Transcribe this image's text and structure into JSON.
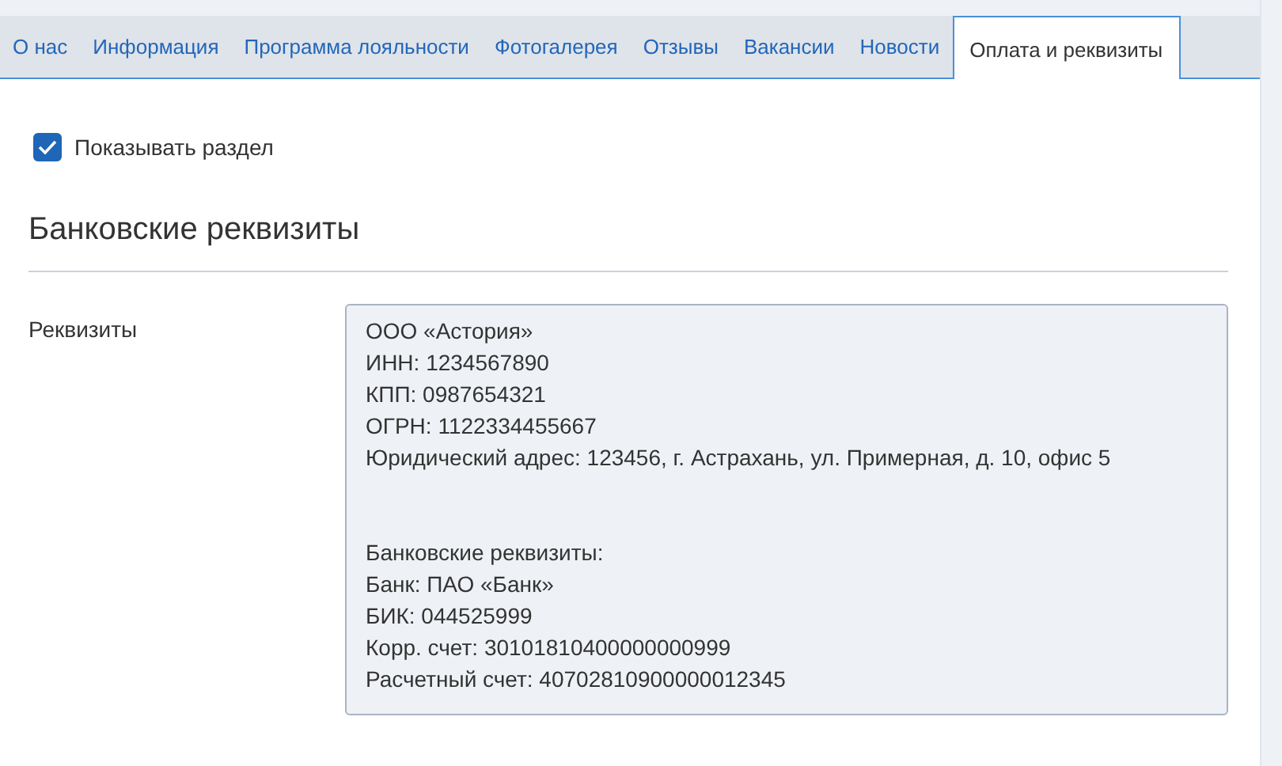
{
  "tabs": [
    {
      "label": "О нас",
      "selected": false
    },
    {
      "label": "Информация",
      "selected": false
    },
    {
      "label": "Программа лояльности",
      "selected": false
    },
    {
      "label": "Фотогалерея",
      "selected": false
    },
    {
      "label": "Отзывы",
      "selected": false
    },
    {
      "label": "Вакансии",
      "selected": false
    },
    {
      "label": "Новости",
      "selected": false
    },
    {
      "label": "Оплата и реквизиты",
      "selected": true
    }
  ],
  "show_section": {
    "label": "Показывать раздел",
    "checked": true
  },
  "section": {
    "title": "Банковские реквизиты",
    "field": {
      "label": "Реквизиты",
      "value": "ООО «Астория»\nИНН: 1234567890\nКПП: 0987654321\nОГРН: 1122334455667\nЮридический адрес: 123456, г. Астрахань, ул. Примерная, д. 10, офис 5\n\n\nБанковские реквизиты:\nБанк: ПАО «Банк»\nБИК: 044525999\nКорр. счет: 30101810400000000999\nРасчетный счет: 40702810900000012345"
    }
  }
}
